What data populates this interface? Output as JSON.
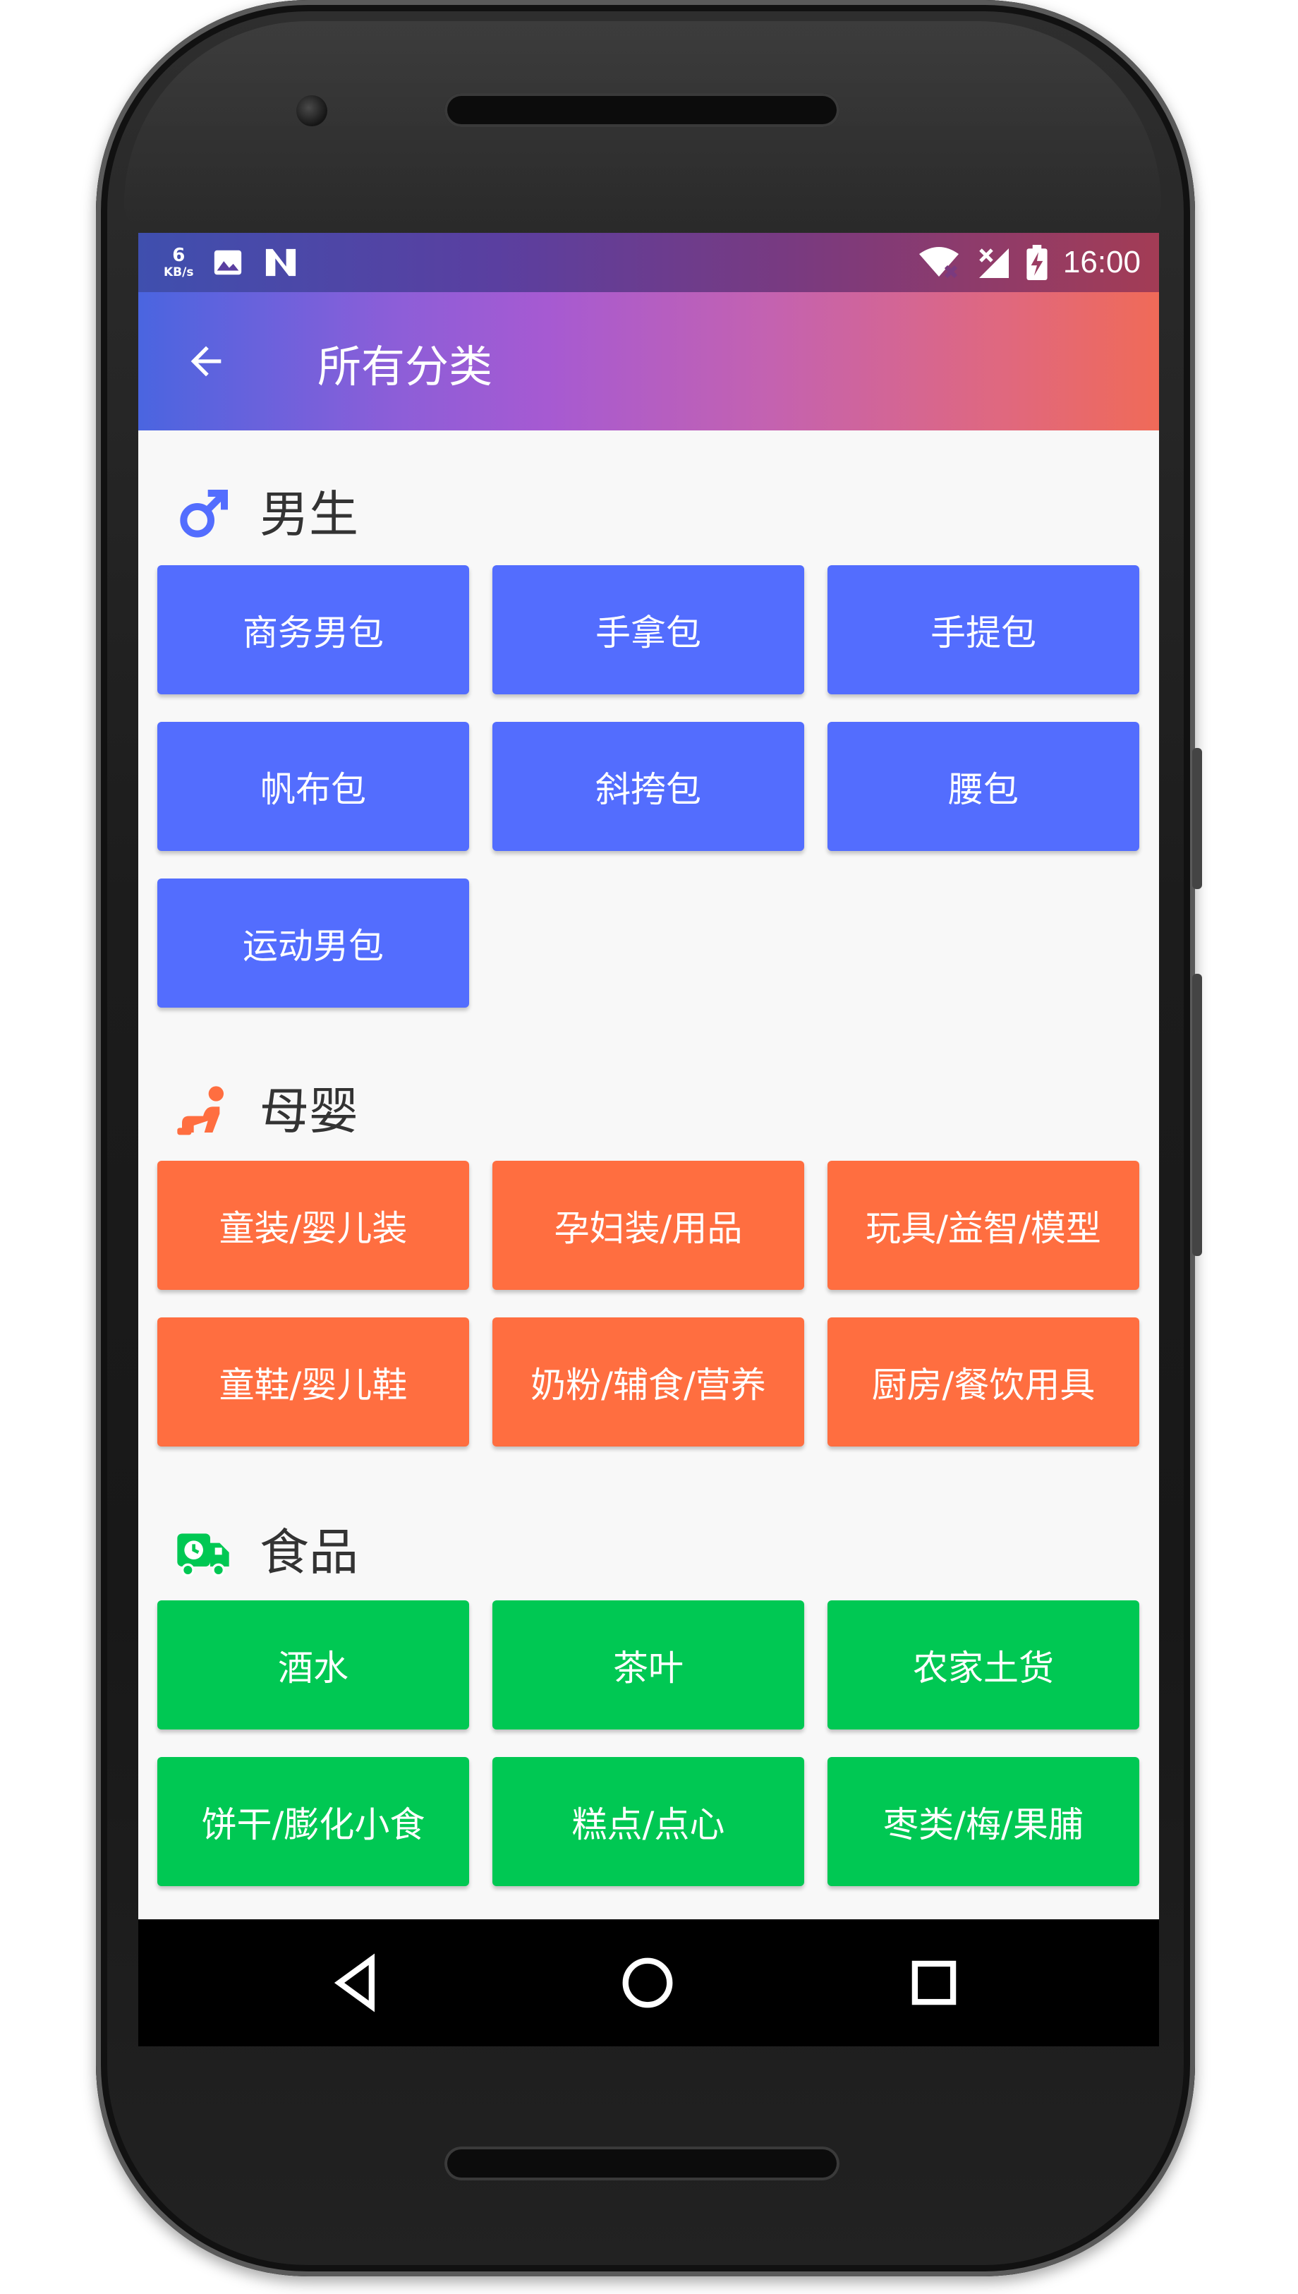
{
  "status_bar": {
    "speed_value": "6",
    "speed_unit": "KB/s",
    "time": "16:00",
    "left_icons": [
      "image-icon",
      "n-notification-icon"
    ],
    "right_icons": [
      "wifi-off-icon",
      "signal-off-icon",
      "battery-charging-icon"
    ]
  },
  "app_bar": {
    "back_icon": "arrow-back-icon",
    "title": "所有分类"
  },
  "sections": [
    {
      "title": "男生",
      "icon": "male-symbol-icon",
      "color": "#536DFE",
      "items": [
        "商务男包",
        "手拿包",
        "手提包",
        "帆布包",
        "斜挎包",
        "腰包",
        "运动男包"
      ]
    },
    {
      "title": "母婴",
      "icon": "crawling-baby-icon",
      "color": "#FF6E40",
      "items": [
        "童装/婴儿装",
        "孕妇装/用品",
        "玩具/益智/模型",
        "童鞋/婴儿鞋",
        "奶粉/辅食/营养",
        "厨房/餐饮用具"
      ]
    },
    {
      "title": "食品",
      "icon": "delivery-truck-icon",
      "color": "#00C853",
      "items": [
        "酒水",
        "茶叶",
        "农家土货",
        "饼干/膨化小食",
        "糕点/点心",
        "枣类/梅/果脯"
      ]
    }
  ],
  "nav_bar": {
    "back": "triangle-back-icon",
    "home": "circle-home-icon",
    "recents": "square-recents-icon"
  }
}
